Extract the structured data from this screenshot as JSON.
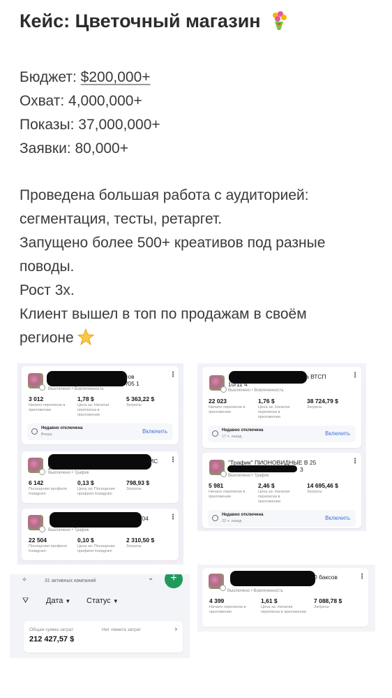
{
  "header": {
    "title": "Кейс: Цветочный магазин"
  },
  "stats": [
    {
      "label": "Бюджет:",
      "value": "$200,000+"
    },
    {
      "label": "Охват:",
      "value": "4,000,000+"
    },
    {
      "label": "Показы:",
      "value": "37,000,000+"
    },
    {
      "label": "Заявки:",
      "value": "80,000+"
    }
  ],
  "description": {
    "line1": "Проведена большая работа с аудиторией:",
    "line2": "сегментация, тесты, ретаргет.",
    "line3": "Запущено более 500+ креативов под разные",
    "line4": "поводы.",
    "line5": "Рост 3х.",
    "line6": "Клиент вышел в топ по продажам в своём",
    "line7": "регионе"
  },
  "campaigns": {
    "c1": {
      "name": "сов",
      "name2": "/05 1",
      "status": "Выключено • Вовлеченность",
      "m1": {
        "v": "3 012",
        "l": "Начало переписки в приложении"
      },
      "m2": {
        "v": "1,78 $",
        "l": "Цена за: Начатая переписка в приложении"
      },
      "m3": {
        "v": "5 363,22 $",
        "l": "Затраты"
      },
      "off_title": "Недавно отключена",
      "off_time": "Вчера",
      "enable": "Включить"
    },
    "c2": {
      "name": "ИС",
      "name2": "2",
      "status": "Выключено • Трафик",
      "m1": {
        "v": "6 142",
        "l": "Посещения профиля Instagram"
      },
      "m2": {
        "v": "0,13 $",
        "l": "Цена за: Посещение профиля Instagram"
      },
      "m3": {
        "v": "798,93 $",
        "l": "Затраты"
      }
    },
    "c3": {
      "name": "/04",
      "status": "Выключено • Трафик",
      "m1": {
        "v": "22 504",
        "l": "Посещения профиля Instagram"
      },
      "m2": {
        "v": "0,10 $",
        "l": "Цена за: Посещение профиля Instagram"
      },
      "m3": {
        "v": "2 310,50 $",
        "l": "Затраты"
      }
    },
    "c4": {
      "name": "а ВТСП",
      "name2": "10/11 4",
      "status": "Выключено • Вовлеченность",
      "m1": {
        "v": "22 023",
        "l": "Начало переписки в приложении"
      },
      "m2": {
        "v": "1,76 $",
        "l": "Цена за: Начатая переписка в приложении"
      },
      "m3": {
        "v": "38 724,79 $",
        "l": "Затраты"
      },
      "off_title": "Недавно отключена",
      "off_time": "17 ч. назад",
      "enable": "Включить"
    },
    "c5": {
      "name": "\"Трафик\" ПИОНОВИДНЫЕ В 25",
      "name2": "3",
      "status": "Выключено • Трафик",
      "m1": {
        "v": "5 981",
        "l": "Начало переписки в приложении"
      },
      "m2": {
        "v": "2,46 $",
        "l": "Цена за: Начатая переписка в приложении"
      },
      "m3": {
        "v": "14 695,46 $",
        "l": "Затраты"
      },
      "off_title": "Недавно отключена",
      "off_time": "22 ч. назад",
      "enable": "Включить"
    },
    "c6": {
      "name": "0 баксов",
      "status": "Выключено • Вовлеченность",
      "m1": {
        "v": "4 399",
        "l": "Начало переписки в приложении"
      },
      "m2": {
        "v": "1,61 $",
        "l": "Цена за: Начатая переписка в приложении"
      },
      "m3": {
        "v": "7 088,78 $",
        "l": "Затраты"
      }
    }
  },
  "summary": {
    "active": "31 активных кампаний",
    "filter_date": "Дата",
    "filter_status": "Статус",
    "total_label": "Общая сумма затрат",
    "total_value": "212 427,57 $",
    "limit": "Нет лимита затрат"
  },
  "colors": {
    "accent": "#3a6fd9",
    "text": "#3a3a3c",
    "add_button": "#1f9a5a"
  }
}
